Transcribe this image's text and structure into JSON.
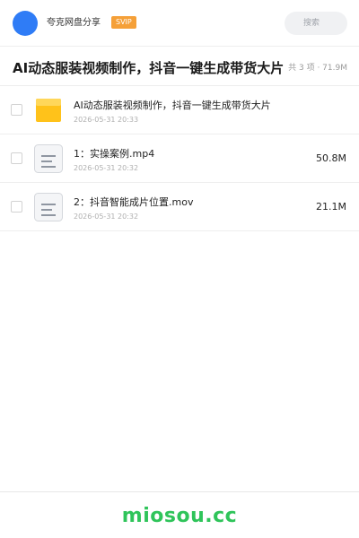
{
  "header": {
    "share_name": "夸克网盘分享",
    "vip_badge": "SVIP",
    "search_placeholder": "搜索"
  },
  "title": {
    "text": "AI动态服装视频制作，抖音一键生成带货大片",
    "summary": "共 3 项 · 71.9M"
  },
  "files": [
    {
      "name": "AI动态服装视频制作，抖音一键生成带货大片",
      "date": "2026-05-31 20:33",
      "size": "",
      "icon": "folder-icon"
    },
    {
      "name": "1：实操案例.mp4",
      "date": "2026-05-31 20:32",
      "size": "50.8M",
      "icon": "video-file-icon"
    },
    {
      "name": "2：抖音智能成片位置.mov",
      "date": "2026-05-31 20:32",
      "size": "21.1M",
      "icon": "video-file-icon"
    }
  ],
  "footer": {
    "logo_text": "miosou.cc"
  },
  "colors": {
    "accent_blue": "#2f7cf6",
    "vip_orange": "#f5a038",
    "folder_yellow": "#ffc21a",
    "logo_green": "#2fc45a"
  }
}
